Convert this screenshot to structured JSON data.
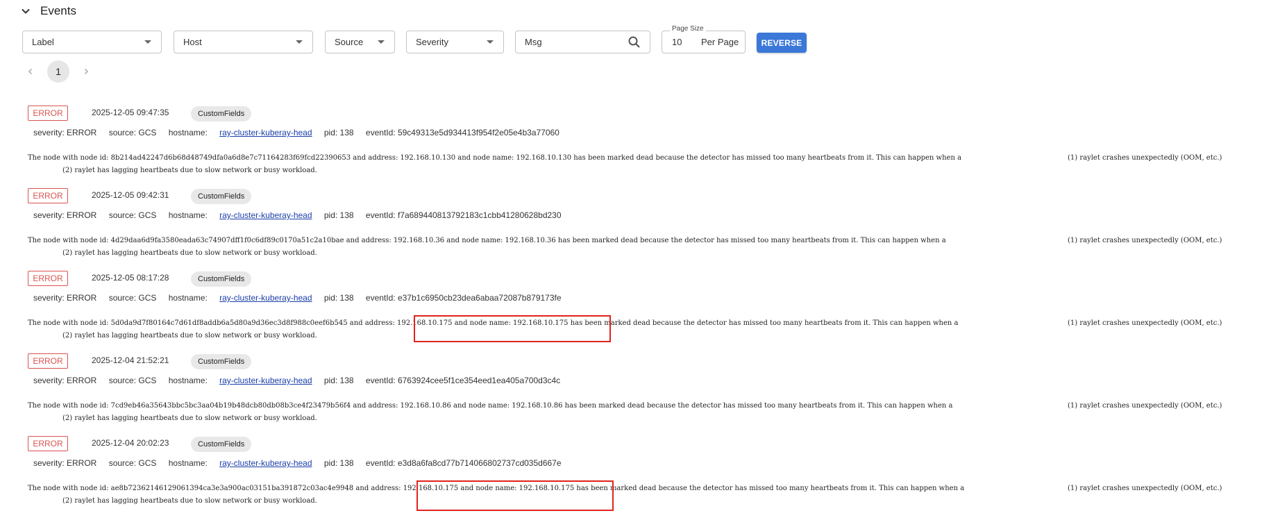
{
  "header": {
    "title": "Events"
  },
  "filters": {
    "label": "Label",
    "host": "Host",
    "source": "Source",
    "severity": "Severity",
    "msg_placeholder": "Msg",
    "page_size_legend": "Page Size",
    "page_size_value": "10",
    "page_size_unit": "Per Page",
    "reverse_label": "REVERSE"
  },
  "pagination": {
    "current": "1"
  },
  "events": [
    {
      "level": "ERROR",
      "time": "2025-12-05 09:47:35",
      "chip": "CustomFields",
      "severity": "severity: ERROR",
      "source": "source: GCS",
      "hostname_label": "hostname:",
      "hostname": "ray-cluster-kuberay-head",
      "pid": "pid: 138",
      "eventid": "eventId: 59c49313e5d934413f954f2e05e4b3a77060",
      "message": "The node with node id: 8b214ad42247d6b68d48749dfa0a6d8e7c71164283f69fcd22390653 and address: 192.168.10.130 and node name: 192.168.10.130 has been marked dead because the detector has missed too many heartbeats from it. This can happen when a",
      "message_tail": "(1) raylet crashes unexpectedly (OOM, etc.)",
      "message_line2": "(2) raylet has lagging heartbeats due to slow network or busy workload."
    },
    {
      "level": "ERROR",
      "time": "2025-12-05 09:42:31",
      "chip": "CustomFields",
      "severity": "severity: ERROR",
      "source": "source: GCS",
      "hostname_label": "hostname:",
      "hostname": "ray-cluster-kuberay-head",
      "pid": "pid: 138",
      "eventid": "eventId: f7a689440813792183c1cbb41280628bd230",
      "message": "The node with node id: 4d29daa6d9fa3580eada63c74907dff1f0c6df89c0170a51c2a10bae and address: 192.168.10.36 and node name: 192.168.10.36 has been marked dead because the detector has missed too many heartbeats from it. This can happen when a",
      "message_tail": "(1) raylet crashes unexpectedly (OOM, etc.)",
      "message_line2": "(2) raylet has lagging heartbeats due to slow network or busy workload."
    },
    {
      "level": "ERROR",
      "time": "2025-12-05 08:17:28",
      "chip": "CustomFields",
      "severity": "severity: ERROR",
      "source": "source: GCS",
      "hostname_label": "hostname:",
      "hostname": "ray-cluster-kuberay-head",
      "pid": "pid: 138",
      "eventid": "eventId: e37b1c6950cb23dea6abaa72087b879173fe",
      "message": "The node with node id: 5d0da9d7f80164c7d61df8addb6a5d80a9d36ec3d8f988c0eef6b545 and address: 192.168.10.175 and node name: 192.168.10.175 has been marked dead because the detector has missed too many heartbeats from it. This can happen when a",
      "message_tail": "(1) raylet crashes unexpectedly (OOM, etc.)",
      "message_line2": "(2) raylet has lagging heartbeats due to slow network or busy workload."
    },
    {
      "level": "ERROR",
      "time": "2025-12-04 21:52:21",
      "chip": "CustomFields",
      "severity": "severity: ERROR",
      "source": "source: GCS",
      "hostname_label": "hostname:",
      "hostname": "ray-cluster-kuberay-head",
      "pid": "pid: 138",
      "eventid": "eventId: 6763924cee5f1ce354eed1ea405a700d3c4c",
      "message": "The node with node id: 7cd9eb46a35643bbc5bc3aa04b19b48dcb80db08b3ce4f23479b56f4 and address: 192.168.10.86 and node name: 192.168.10.86 has been marked dead because the detector has missed too many heartbeats from it. This can happen when a",
      "message_tail": "(1) raylet crashes unexpectedly (OOM, etc.)",
      "message_line2": "(2) raylet has lagging heartbeats due to slow network or busy workload."
    },
    {
      "level": "ERROR",
      "time": "2025-12-04 20:02:23",
      "chip": "CustomFields",
      "severity": "severity: ERROR",
      "source": "source: GCS",
      "hostname_label": "hostname:",
      "hostname": "ray-cluster-kuberay-head",
      "pid": "pid: 138",
      "eventid": "eventId: e3d8a6fa8cd77b714066802737cd035d667e",
      "message": "The node with node id: ae8b72362146129061394ca3e3a900ac03151ba391872c03ac4e9948 and address: 192.168.10.175 and node name: 192.168.10.175 has been marked dead because the detector has missed too many heartbeats from it. This can happen when a",
      "message_tail": "(1) raylet crashes unexpectedly (OOM, etc.)",
      "message_line2": "(2) raylet has lagging heartbeats due to slow network or busy workload."
    }
  ]
}
